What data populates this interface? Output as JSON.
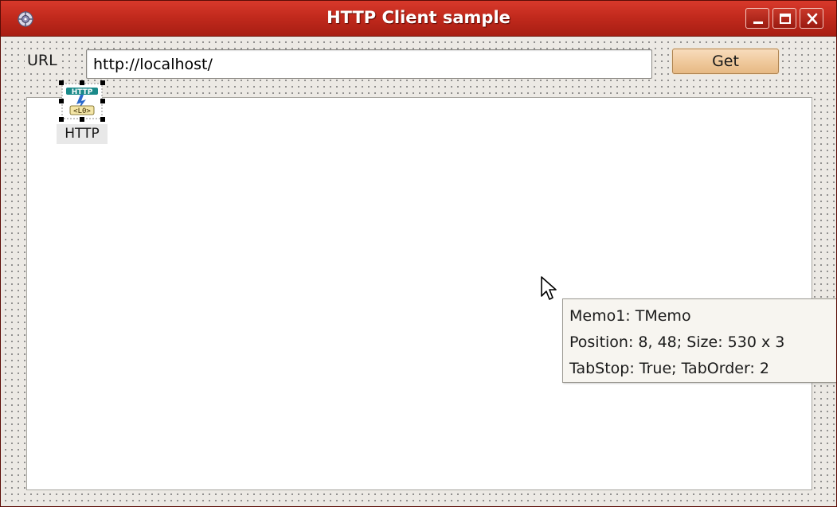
{
  "window": {
    "title": "HTTP Client sample",
    "icon": "app-icon",
    "controls": {
      "minimize": "minimize-icon",
      "maximize": "maximize-icon",
      "close": "close-icon"
    }
  },
  "form": {
    "url_label": "URL",
    "url_value": "http://localhost/",
    "get_label": "Get",
    "component": {
      "label": "HTTP",
      "icon": "http-component-icon"
    }
  },
  "tooltip": {
    "lines": [
      "Memo1: TMemo",
      "Position: 8, 48; Size: 530 x 3",
      "TabStop: True; TabOrder: 2"
    ]
  },
  "colors": {
    "titlebar": "#c22a1d",
    "button": "#efc89b",
    "form_background": "#ece9e4"
  }
}
